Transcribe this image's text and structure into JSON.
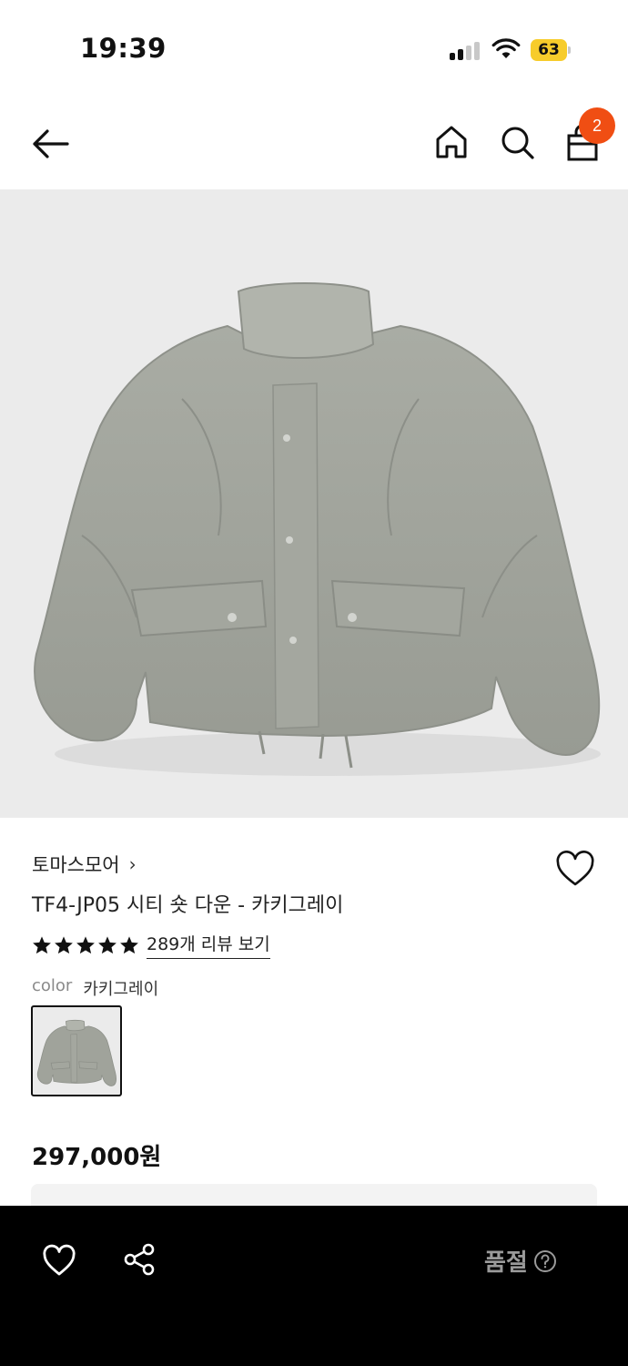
{
  "status_bar": {
    "time": "19:39",
    "battery": "63"
  },
  "header": {
    "cart_count": "2"
  },
  "product": {
    "brand": "토마스모어",
    "brand_chevron": "›",
    "title": "TF4-JP05 시티 숏 다운 - 카키그레이",
    "rating_stars": 5,
    "review_link": "289개 리뷰 보기",
    "color_label": "color",
    "color_value": "카키그레이",
    "price": "297,000원"
  },
  "bottom_bar": {
    "status_label": "품절"
  },
  "colors": {
    "badge": "#f04e13",
    "battery": "#f7cc2b",
    "image_bg": "#ebebeb",
    "jacket": "#9fa29a",
    "bottom_bar": "#000000",
    "soldout_text": "#9a9a9a"
  },
  "icons": [
    "back-arrow-icon",
    "home-icon",
    "search-icon",
    "shopping-bag-icon",
    "heart-icon",
    "star-icon",
    "share-icon",
    "help-circle-icon"
  ]
}
